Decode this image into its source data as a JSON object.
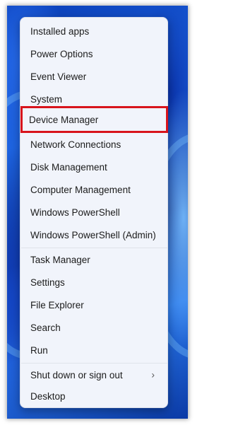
{
  "menu": {
    "group1": [
      "Installed apps",
      "Power Options",
      "Event Viewer",
      "System",
      "Device Manager",
      "Network Connections",
      "Disk Management",
      "Computer Management",
      "Windows PowerShell",
      "Windows PowerShell (Admin)"
    ],
    "group2": [
      "Task Manager",
      "Settings",
      "File Explorer",
      "Search",
      "Run"
    ],
    "shutdown_label": "Shut down or sign out",
    "desktop_label": "Desktop",
    "highlighted_item": "Device Manager",
    "highlight_color": "#d8141c",
    "submenu_icon": "chevron-right-icon"
  }
}
